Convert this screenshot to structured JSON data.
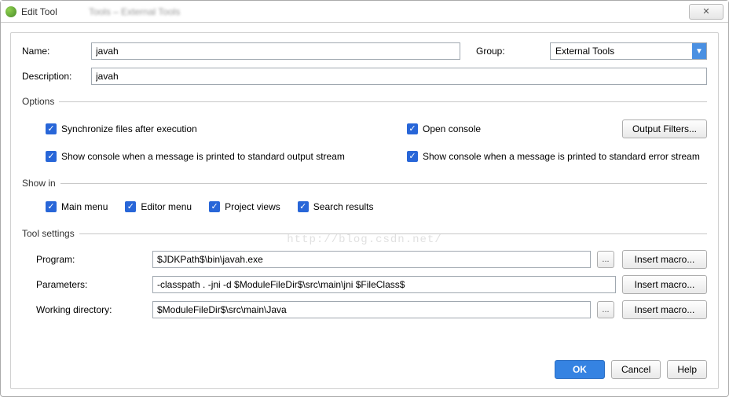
{
  "window": {
    "title": "Edit Tool",
    "ghost": "Tools – External Tools",
    "close": "✕"
  },
  "fields": {
    "name_label": "Name:",
    "name_value": "javah",
    "group_label": "Group:",
    "group_value": "External Tools",
    "desc_label": "Description:",
    "desc_value": "javah"
  },
  "sections": {
    "options": "Options",
    "showin": "Show in",
    "tool": "Tool settings"
  },
  "options": {
    "sync": "Synchronize files after execution",
    "open_console": "Open console",
    "out_filters": "Output Filters...",
    "stdout": "Show console when a message is printed to standard output stream",
    "stderr": "Show console when a message is printed to standard error stream"
  },
  "showin": {
    "main": "Main menu",
    "editor": "Editor menu",
    "project": "Project views",
    "search": "Search results"
  },
  "tool": {
    "program_label": "Program:",
    "program_value": "$JDKPath$\\bin\\javah.exe",
    "params_label": "Parameters:",
    "params_value": "-classpath . -jni -d $ModuleFileDir$\\src\\main\\jni $FileClass$",
    "workdir_label": "Working directory:",
    "workdir_value": "$ModuleFileDir$\\src\\main\\Java",
    "browse": "...",
    "insert_macro": "Insert macro..."
  },
  "footer": {
    "ok": "OK",
    "cancel": "Cancel",
    "help": "Help"
  },
  "watermark": "http://blog.csdn.net/",
  "checkmark": "✓"
}
